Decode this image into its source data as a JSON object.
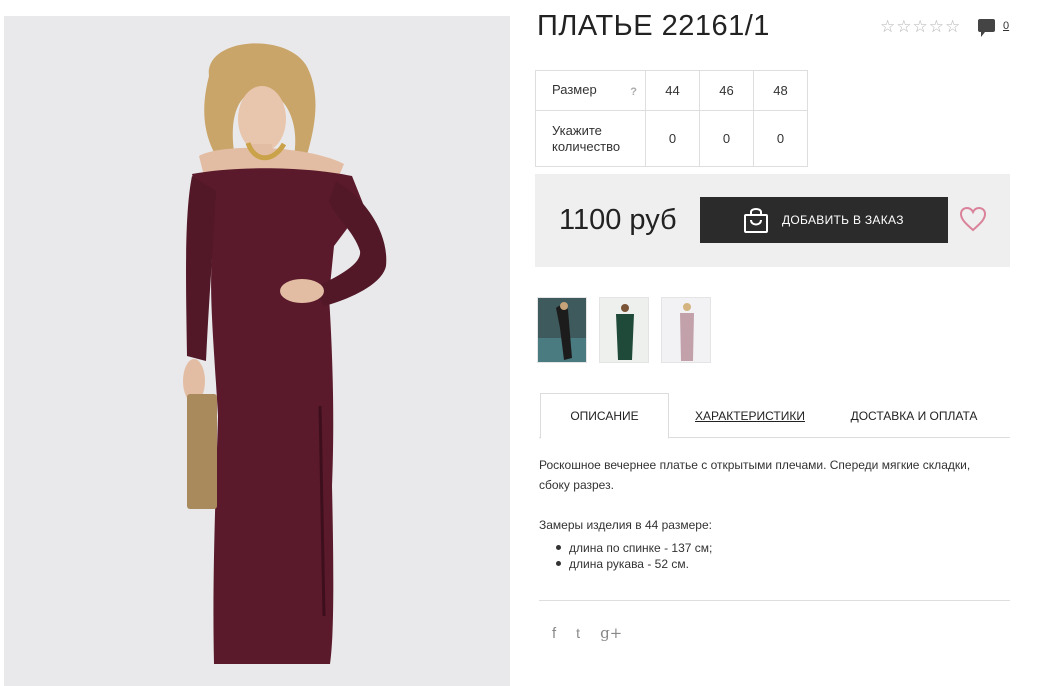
{
  "product": {
    "title": "ПЛАТЬЕ 22161/1",
    "rating_stars": 5,
    "comments_count": "0"
  },
  "sizes_table": {
    "size_label": "Размер",
    "help_label": "?",
    "sizes": [
      "44",
      "46",
      "48"
    ],
    "qty_label": "Укажите количество",
    "quantities": [
      "0",
      "0",
      "0"
    ]
  },
  "buy": {
    "price": "1100 руб",
    "add_button_label": "ДОБАВИТЬ В ЗАКАЗ"
  },
  "tabs": [
    {
      "label": "ОПИСАНИЕ",
      "active": true
    },
    {
      "label": "ХАРАКТЕРИСТИКИ",
      "active": false
    },
    {
      "label": "ДОСТАВКА И ОПЛАТА",
      "active": false
    }
  ],
  "description": {
    "text": "Роскошное вечернее платье с открытыми плечами. Спереди мягкие складки, сбоку разрез.",
    "measure_title": "Замеры изделия в 44 размере:",
    "measures": [
      "длина по спинке - 137 см;",
      "длина рукава - 52 см."
    ]
  },
  "social": {
    "facebook": "f",
    "twitter": "t",
    "google_plus": "g+"
  },
  "colors": {
    "dress": "#5a1a2c",
    "button_bg": "#2b2b2b",
    "heart": "#d9829a",
    "buy_box_bg": "#efefef"
  }
}
